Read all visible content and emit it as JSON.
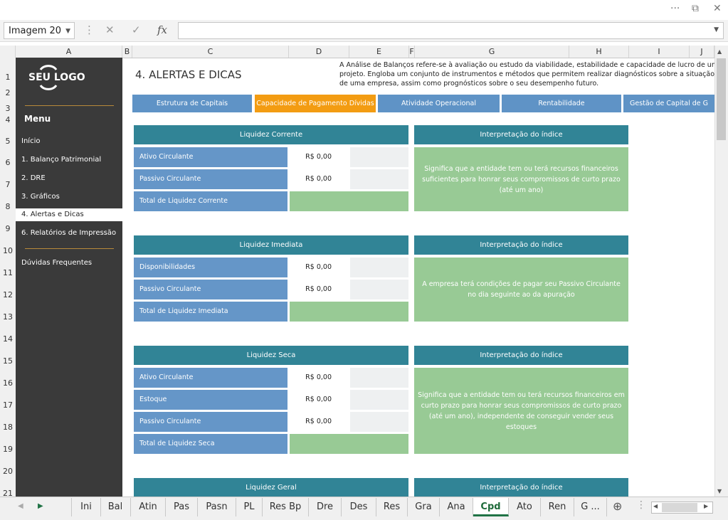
{
  "window": {
    "more": "···",
    "restore": "⧉",
    "close": "✕"
  },
  "formula_bar": {
    "name_box": "Imagem 20",
    "fx": "fx",
    "formula": ""
  },
  "columns": [
    "A",
    "B",
    "C",
    "D",
    "E",
    "F",
    "G",
    "H",
    "I",
    "J"
  ],
  "rows": [
    "1",
    "2",
    "3",
    "4",
    "5",
    "6",
    "7",
    "8",
    "9",
    "10",
    "11",
    "12",
    "13",
    "14",
    "15",
    "16",
    "17",
    "18",
    "19",
    "20",
    "21"
  ],
  "sidebar": {
    "logo": "SEU LOGO",
    "menu_title": "Menu",
    "items": [
      {
        "label": "Início"
      },
      {
        "label": "1. Balanço Patrimonial"
      },
      {
        "label": "2. DRE"
      },
      {
        "label": "3. Gráficos"
      },
      {
        "label": "4. Alertas e Dicas"
      },
      {
        "label": "6. Relatórios de Impressão"
      }
    ],
    "faq": "Dúvidas Frequentes"
  },
  "page": {
    "title": "4. ALERTAS E DICAS",
    "description": [
      "A Análise de Balanços refere-se à avaliação ou estudo da viabilidade, estabilidade e capacidade de lucro de um neg",
      "projeto. Engloba um conjunto de instrumentos e métodos que permitem realizar diagnósticos sobre a situação fina",
      "de uma empresa, assim como prognósticos sobre o seu desempenho futuro."
    ]
  },
  "tabs": [
    {
      "label": "Estrutura de Capitais"
    },
    {
      "label": "Capacidade de Pagamento Dívidas"
    },
    {
      "label": "Atividade Operacional"
    },
    {
      "label": "Rentabilidade"
    },
    {
      "label": "Gestão de Capital de G"
    }
  ],
  "interp_title": "Interpretação do índice",
  "sections": [
    {
      "title": "Liquidez Corrente",
      "rows": [
        {
          "label": "Ativo Circulante",
          "value": "R$ 0,00"
        },
        {
          "label": "Passivo Circulante",
          "value": "R$ 0,00"
        }
      ],
      "total": "Total de Liquidez Corrente",
      "interpretation": "Significa que a entidade tem ou terá recursos financeiros suficientes para honrar seus compromissos de curto prazo (até um ano)"
    },
    {
      "title": "Liquidez Imediata",
      "rows": [
        {
          "label": "Disponibilidades",
          "value": "R$ 0,00"
        },
        {
          "label": "Passivo Circulante",
          "value": "R$ 0,00"
        }
      ],
      "total": "Total de Liquidez Imediata",
      "interpretation": "A empresa terá condições de pagar seu Passivo Circulante no dia seguinte ao da apuração"
    },
    {
      "title": "Liquidez Seca",
      "rows": [
        {
          "label": "Ativo Circulante",
          "value": "R$ 0,00"
        },
        {
          "label": "Estoque",
          "value": "R$ 0,00"
        },
        {
          "label": "Passivo Circulante",
          "value": "R$ 0,00"
        }
      ],
      "total": "Total de Liquidez Seca",
      "interpretation": "Significa que a entidade tem ou terá recursos financeiros em curto prazo para honrar seus compromissos de curto prazo (até um ano), independente de conseguir vender seus estoques"
    },
    {
      "title": "Liquidez Geral"
    }
  ],
  "sheet_tabs": [
    "Ini",
    "Bal",
    "Atin",
    "Pas",
    "Pasn",
    "PL",
    "Res Bp",
    "Dre",
    "Des",
    "Res",
    "Gra",
    "Ana",
    "Cpd",
    "Ato",
    "Ren",
    "G ..."
  ],
  "active_sheet": "Cpd",
  "colors": {
    "tab": "#5f93c6",
    "tab_active": "#f39c12",
    "header": "#318496",
    "label": "#6596c8",
    "green": "#98ca95",
    "sidebar": "#3a3a3a"
  }
}
